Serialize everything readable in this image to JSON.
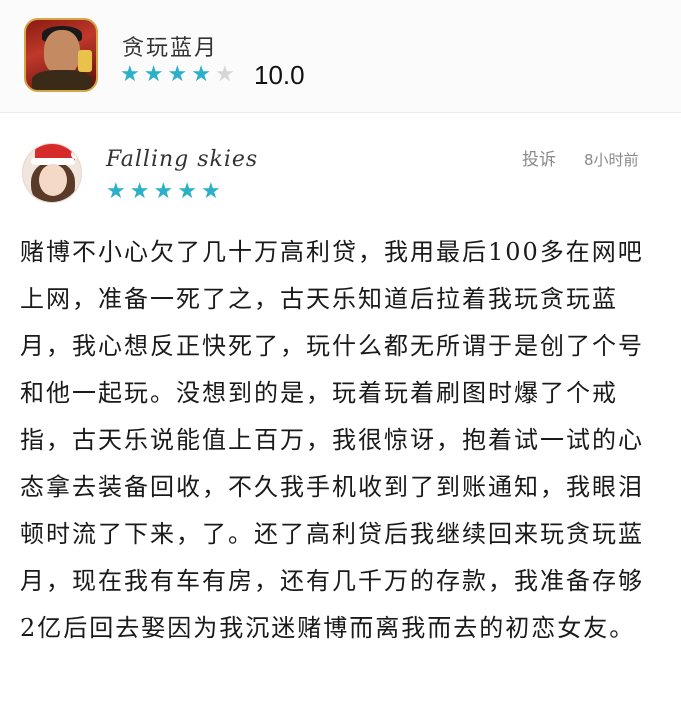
{
  "app": {
    "title": "贪玩蓝月",
    "rating_stars": 4,
    "rating_max": 5,
    "score": "10.0",
    "icon": "game-avatar-icon"
  },
  "review": {
    "user_name": "Falling skies",
    "user_stars": 5,
    "report_label": "投诉",
    "time": "8小时前",
    "avatar": "santa-hat-avatar",
    "text": "赌博不小心欠了几十万高利贷，我用最后100多在网吧上网，准备一死了之，古天乐知道后拉着我玩贪玩蓝月，我心想反正快死了，玩什么都无所谓于是创了个号和他一起玩。没想到的是，玩着玩着刷图时爆了个戒指，古天乐说能值上百万，我很惊讶，抱着试一试的心态拿去装备回收，不久我手机收到了到账通知，我眼泪顿时流了下来，了。还了高利贷后我继续回来玩贪玩蓝月，现在我有车有房，还有几千万的存款，我准备存够2亿后回去娶因为我沉迷赌博而离我而去的初恋女友。"
  },
  "colors": {
    "star_on": "#2ab0c8",
    "star_off": "#d6d6d6",
    "header_bg": "#fbfbfb"
  }
}
